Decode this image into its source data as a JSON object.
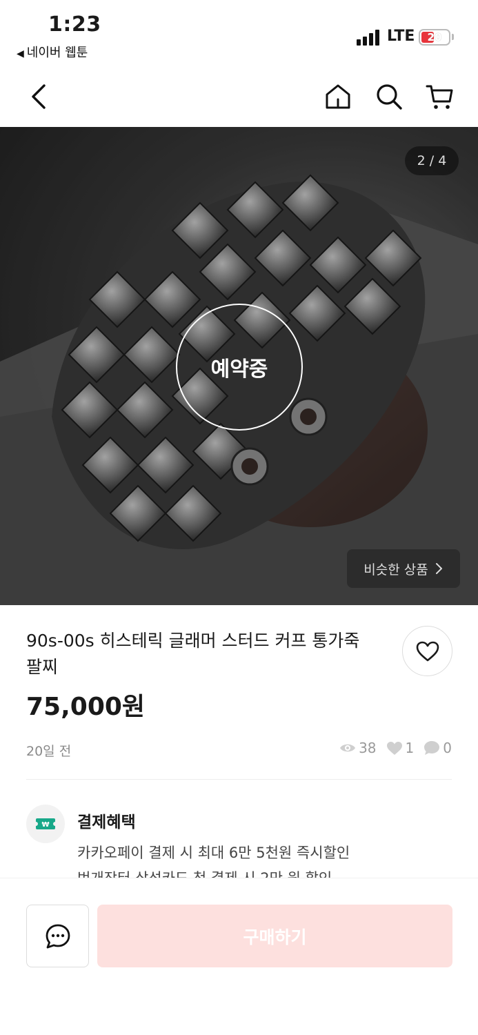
{
  "status_bar": {
    "time": "1:23",
    "back_app": "네이버 웹툰",
    "network": "LTE",
    "battery": "20",
    "battery_color": "#e8343b"
  },
  "nav": {
    "icons": [
      "back-icon",
      "home-icon",
      "search-icon",
      "cart-icon"
    ]
  },
  "hero": {
    "counter": "2 / 4",
    "reserved_label": "예약중",
    "similar_label": "비슷한 상품"
  },
  "product": {
    "title": "90s-00s 히스테릭 글래머 스터드 커프 통가죽 팔찌",
    "price": "75,000원",
    "posted_ago": "20일 전",
    "views": "38",
    "likes": "1",
    "chats": "0"
  },
  "benefit": {
    "title": "결제혜택",
    "line1": "카카오페이 결제 시 최대 6만 5천원 즉시할인",
    "line2": "번개장터 삼성카드 첫 결제 시 2만 원 할인",
    "icon_color": "#17a889"
  },
  "bottom": {
    "buy_label": "구매하기",
    "buy_color": "#fde0de"
  }
}
